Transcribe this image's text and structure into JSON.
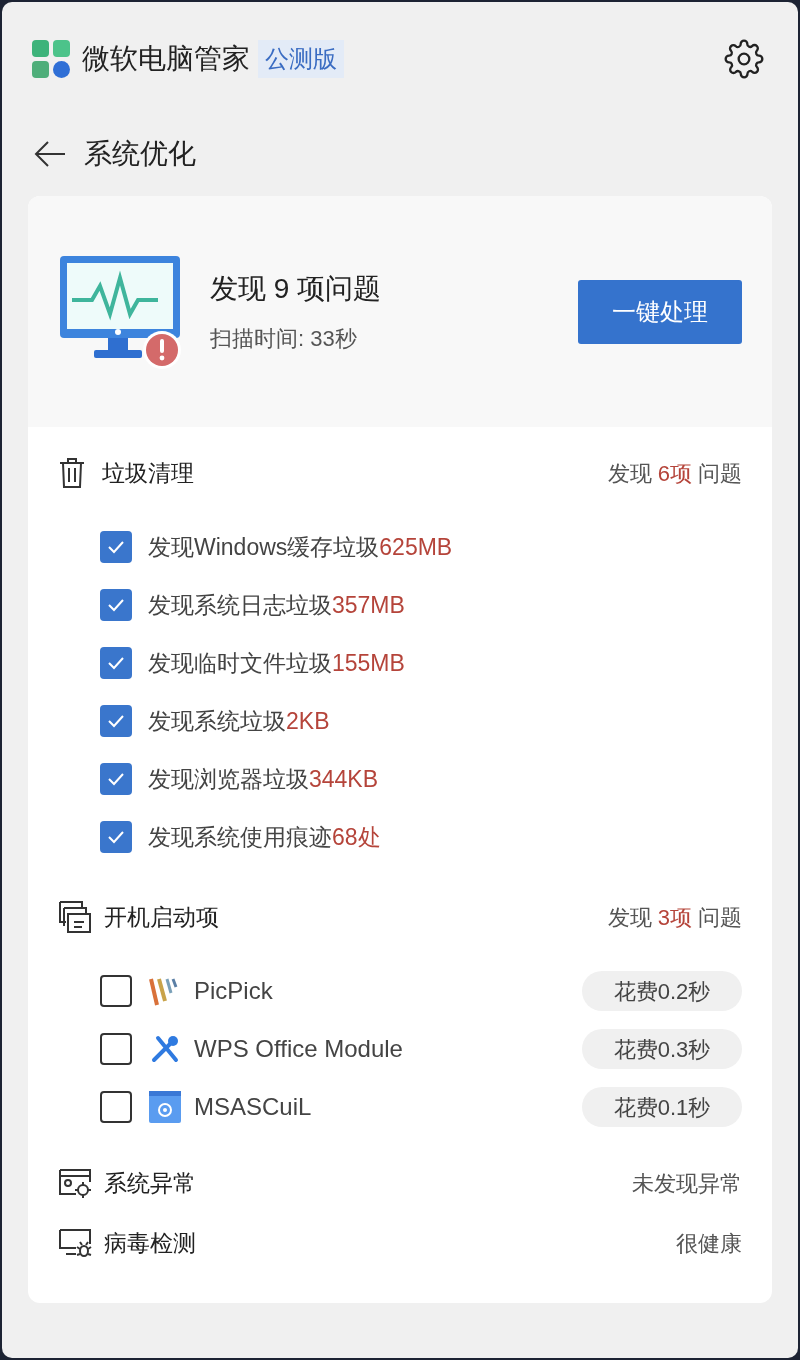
{
  "app": {
    "title": "微软电脑管家",
    "badge": "公测版"
  },
  "page": {
    "title": "系统优化"
  },
  "summary": {
    "headline": "发现 9 项问题",
    "scan_time": "扫描时间: 33秒",
    "action": "一键处理"
  },
  "junk": {
    "title": "垃圾清理",
    "found_prefix": "发现",
    "found_count": "6项",
    "found_suffix": "问题",
    "items": [
      {
        "label": "发现Windows缓存垃圾",
        "amount": "625MB",
        "checked": true
      },
      {
        "label": "发现系统日志垃圾",
        "amount": "357MB",
        "checked": true
      },
      {
        "label": "发现临时文件垃圾",
        "amount": "155MB",
        "checked": true
      },
      {
        "label": "发现系统垃圾",
        "amount": "2KB",
        "checked": true
      },
      {
        "label": "发现浏览器垃圾",
        "amount": "344KB",
        "checked": true
      },
      {
        "label": "发现系统使用痕迹",
        "amount": "68处",
        "checked": true
      }
    ]
  },
  "startup": {
    "title": "开机启动项",
    "found_prefix": "发现",
    "found_count": "3项",
    "found_suffix": "问题",
    "items": [
      {
        "name": "PicPick",
        "cost": "花费0.2秒",
        "checked": false
      },
      {
        "name": "WPS Office Module",
        "cost": "花费0.3秒",
        "checked": false
      },
      {
        "name": "MSASCuiL",
        "cost": "花费0.1秒",
        "checked": false
      }
    ]
  },
  "checks": [
    {
      "title": "系统异常",
      "status": "未发现异常"
    },
    {
      "title": "病毒检测",
      "status": "很健康"
    }
  ]
}
